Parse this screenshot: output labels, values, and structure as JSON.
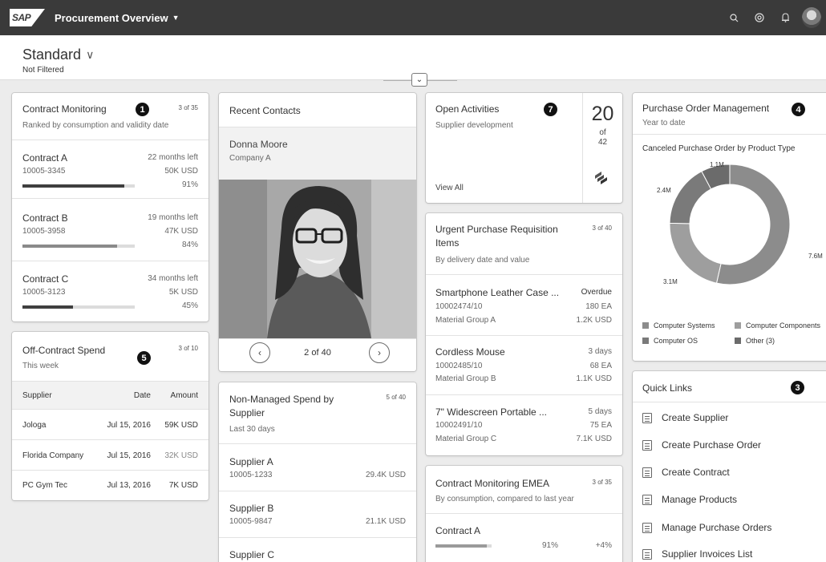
{
  "shell": {
    "logo": "SAP",
    "app_title": "Procurement Overview",
    "icons": [
      "search-icon",
      "notification-icon",
      "bell-icon"
    ]
  },
  "header": {
    "variant": "Standard",
    "filter_status": "Not Filtered"
  },
  "contract_monitoring": {
    "title": "Contract Monitoring",
    "counter": "3 of 35",
    "subtitle": "Ranked by consumption and validity date",
    "badge": "1",
    "items": [
      {
        "name": "Contract A",
        "left": "22 months left",
        "id": "10005-3345",
        "amount": "50K USD",
        "pct": "91%",
        "value": 0.91,
        "color": "#3f3f3f"
      },
      {
        "name": "Contract B",
        "left": "19 months left",
        "id": "10005-3958",
        "amount": "47K USD",
        "pct": "84%",
        "value": 0.84,
        "color": "#8a8a8a"
      },
      {
        "name": "Contract C",
        "left": "34 months left",
        "id": "10005-3123",
        "amount": "5K USD",
        "pct": "45%",
        "value": 0.45,
        "color": "#3f3f3f"
      }
    ]
  },
  "off_contract": {
    "title": "Off-Contract Spend",
    "counter": "3 of 10",
    "subtitle": "This week",
    "badge": "5",
    "columns": [
      "Supplier",
      "Date",
      "Amount"
    ],
    "rows": [
      {
        "supplier": "Jologa",
        "date": "Jul 15, 2016",
        "amount": "59K USD"
      },
      {
        "supplier": "Florida Company",
        "date": "Jul 15, 2016",
        "amount": "32K USD"
      },
      {
        "supplier": "PC Gym Tec",
        "date": "Jul 13, 2016",
        "amount": "7K USD"
      }
    ]
  },
  "recent_contacts": {
    "title": "Recent Contacts",
    "name": "Donna Moore",
    "company": "Company A",
    "pager": "2 of 40"
  },
  "non_managed": {
    "title_line1": "Non-Managed Spend by",
    "title_line2": "Supplier",
    "counter": "5 of 40",
    "subtitle": "Last 30 days",
    "items": [
      {
        "name": "Supplier A",
        "id": "10005-1233",
        "amount": "29.4K USD"
      },
      {
        "name": "Supplier B",
        "id": "10005-9847",
        "amount": "21.1K USD"
      },
      {
        "name": "Supplier C"
      }
    ]
  },
  "open_activities": {
    "title": "Open Activities",
    "subtitle": "Supplier development",
    "badge": "7",
    "count": "20",
    "of": "of",
    "total": "42",
    "view_all": "View All"
  },
  "urgent_pr": {
    "title_line1": "Urgent Purchase Requisition",
    "title_line2": "Items",
    "counter": "3 of 40",
    "subtitle": "By delivery date and value",
    "items": [
      {
        "name": "Smartphone Leather Case ...",
        "status": "Overdue",
        "id": "10002474/10",
        "qty": "180 EA",
        "group": "Material Group A",
        "value": "1.2K USD"
      },
      {
        "name": "Cordless Mouse",
        "status": "3 days",
        "id": "10002485/10",
        "qty": "68 EA",
        "group": "Material Group B",
        "value": "1.1K USD"
      },
      {
        "name": "7\" Widescreen Portable ...",
        "status": "5 days",
        "id": "10002491/10",
        "qty": "75 EA",
        "group": "Material Group C",
        "value": "7.1K USD"
      }
    ]
  },
  "contract_emea": {
    "title": "Contract Monitoring EMEA",
    "counter": "3 of 35",
    "subtitle": "By consumption, compared to last year",
    "item": {
      "name": "Contract A",
      "pct": "91%",
      "delta": "+4%",
      "value": 0.91
    }
  },
  "po_management": {
    "title": "Purchase Order Management",
    "subtitle": "Year to date",
    "badge": "4",
    "chart_title": "Canceled Purchase Order by Product Type"
  },
  "chart_data": {
    "type": "pie",
    "title": "Canceled Purchase Order by Product Type",
    "categories": [
      "Computer Systems",
      "Computer Components",
      "Computer OS",
      "Other (3)"
    ],
    "values": [
      7.6,
      3.1,
      2.4,
      1.1
    ],
    "labels": [
      "7.6M",
      "3.1M",
      "2.4M",
      "1.1M"
    ],
    "colors": [
      "#8c8c8c",
      "#9e9e9e",
      "#7a7a7a",
      "#6b6b6b"
    ],
    "legend": "bottom"
  },
  "quick_links": {
    "title": "Quick Links",
    "badge": "3",
    "items": [
      "Create Supplier",
      "Create Purchase Order",
      "Create Contract",
      "Manage Products",
      "Manage Purchase Orders",
      "Supplier Invoices List"
    ]
  }
}
